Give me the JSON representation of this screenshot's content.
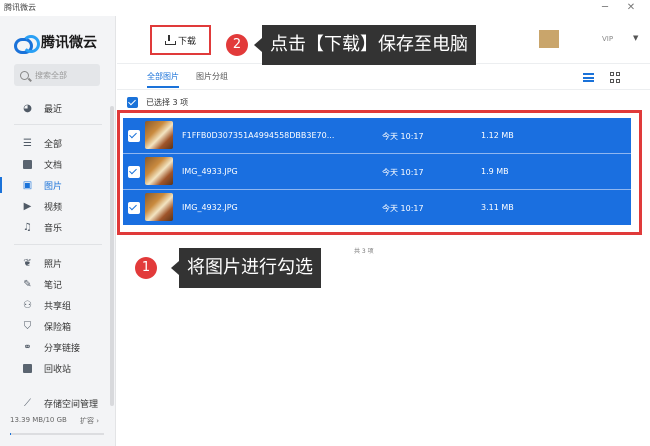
{
  "window": {
    "title": "腾讯微云",
    "minimize": "─",
    "close": "✕"
  },
  "sidebar": {
    "logo_text": "腾讯微云",
    "search_placeholder": "搜索全部",
    "items": [
      {
        "label": "最近",
        "icon": "clock-icon"
      },
      {
        "label": "全部",
        "icon": "stack-icon"
      },
      {
        "label": "文档",
        "icon": "document-icon"
      },
      {
        "label": "图片",
        "icon": "image-icon",
        "active": true
      },
      {
        "label": "视频",
        "icon": "video-icon"
      },
      {
        "label": "音乐",
        "icon": "music-icon"
      },
      {
        "label": "照片",
        "icon": "photo-leaf-icon"
      },
      {
        "label": "笔记",
        "icon": "pen-icon"
      },
      {
        "label": "共享组",
        "icon": "group-icon"
      },
      {
        "label": "保险箱",
        "icon": "shield-icon"
      },
      {
        "label": "分享链接",
        "icon": "share-link-icon"
      },
      {
        "label": "回收站",
        "icon": "trash-icon"
      },
      {
        "label": "存储空间管理",
        "icon": "broom-icon"
      }
    ],
    "storage": {
      "used_text": "13.39 MB/10 GB",
      "expand_label": "扩容 ›",
      "used_fraction": 0.0013
    }
  },
  "toolbar": {
    "download_label": "下载",
    "vip_label": "VIP"
  },
  "tabs": [
    {
      "label": "全部图片",
      "active": true
    },
    {
      "label": "图片分组"
    }
  ],
  "selection": {
    "label": "已选择 3 项"
  },
  "files": [
    {
      "name": "F1FFB0D307351A4994558DBB3E70...",
      "time": "今天 10:17",
      "size": "1.12 MB"
    },
    {
      "name": "IMG_4933.JPG",
      "time": "今天 10:17",
      "size": "1.9 MB"
    },
    {
      "name": "IMG_4932.JPG",
      "time": "今天 10:17",
      "size": "3.11 MB"
    }
  ],
  "total_label": "共 3 项",
  "callouts": [
    {
      "number": "1",
      "text": "将图片进行勾选"
    },
    {
      "number": "2",
      "text": "点击【下载】保存至电脑"
    }
  ],
  "colors": {
    "accent": "#1a72d9",
    "row_selected": "#1a6fe0",
    "highlight": "#e03a3a",
    "callout_bg": "#333333"
  }
}
